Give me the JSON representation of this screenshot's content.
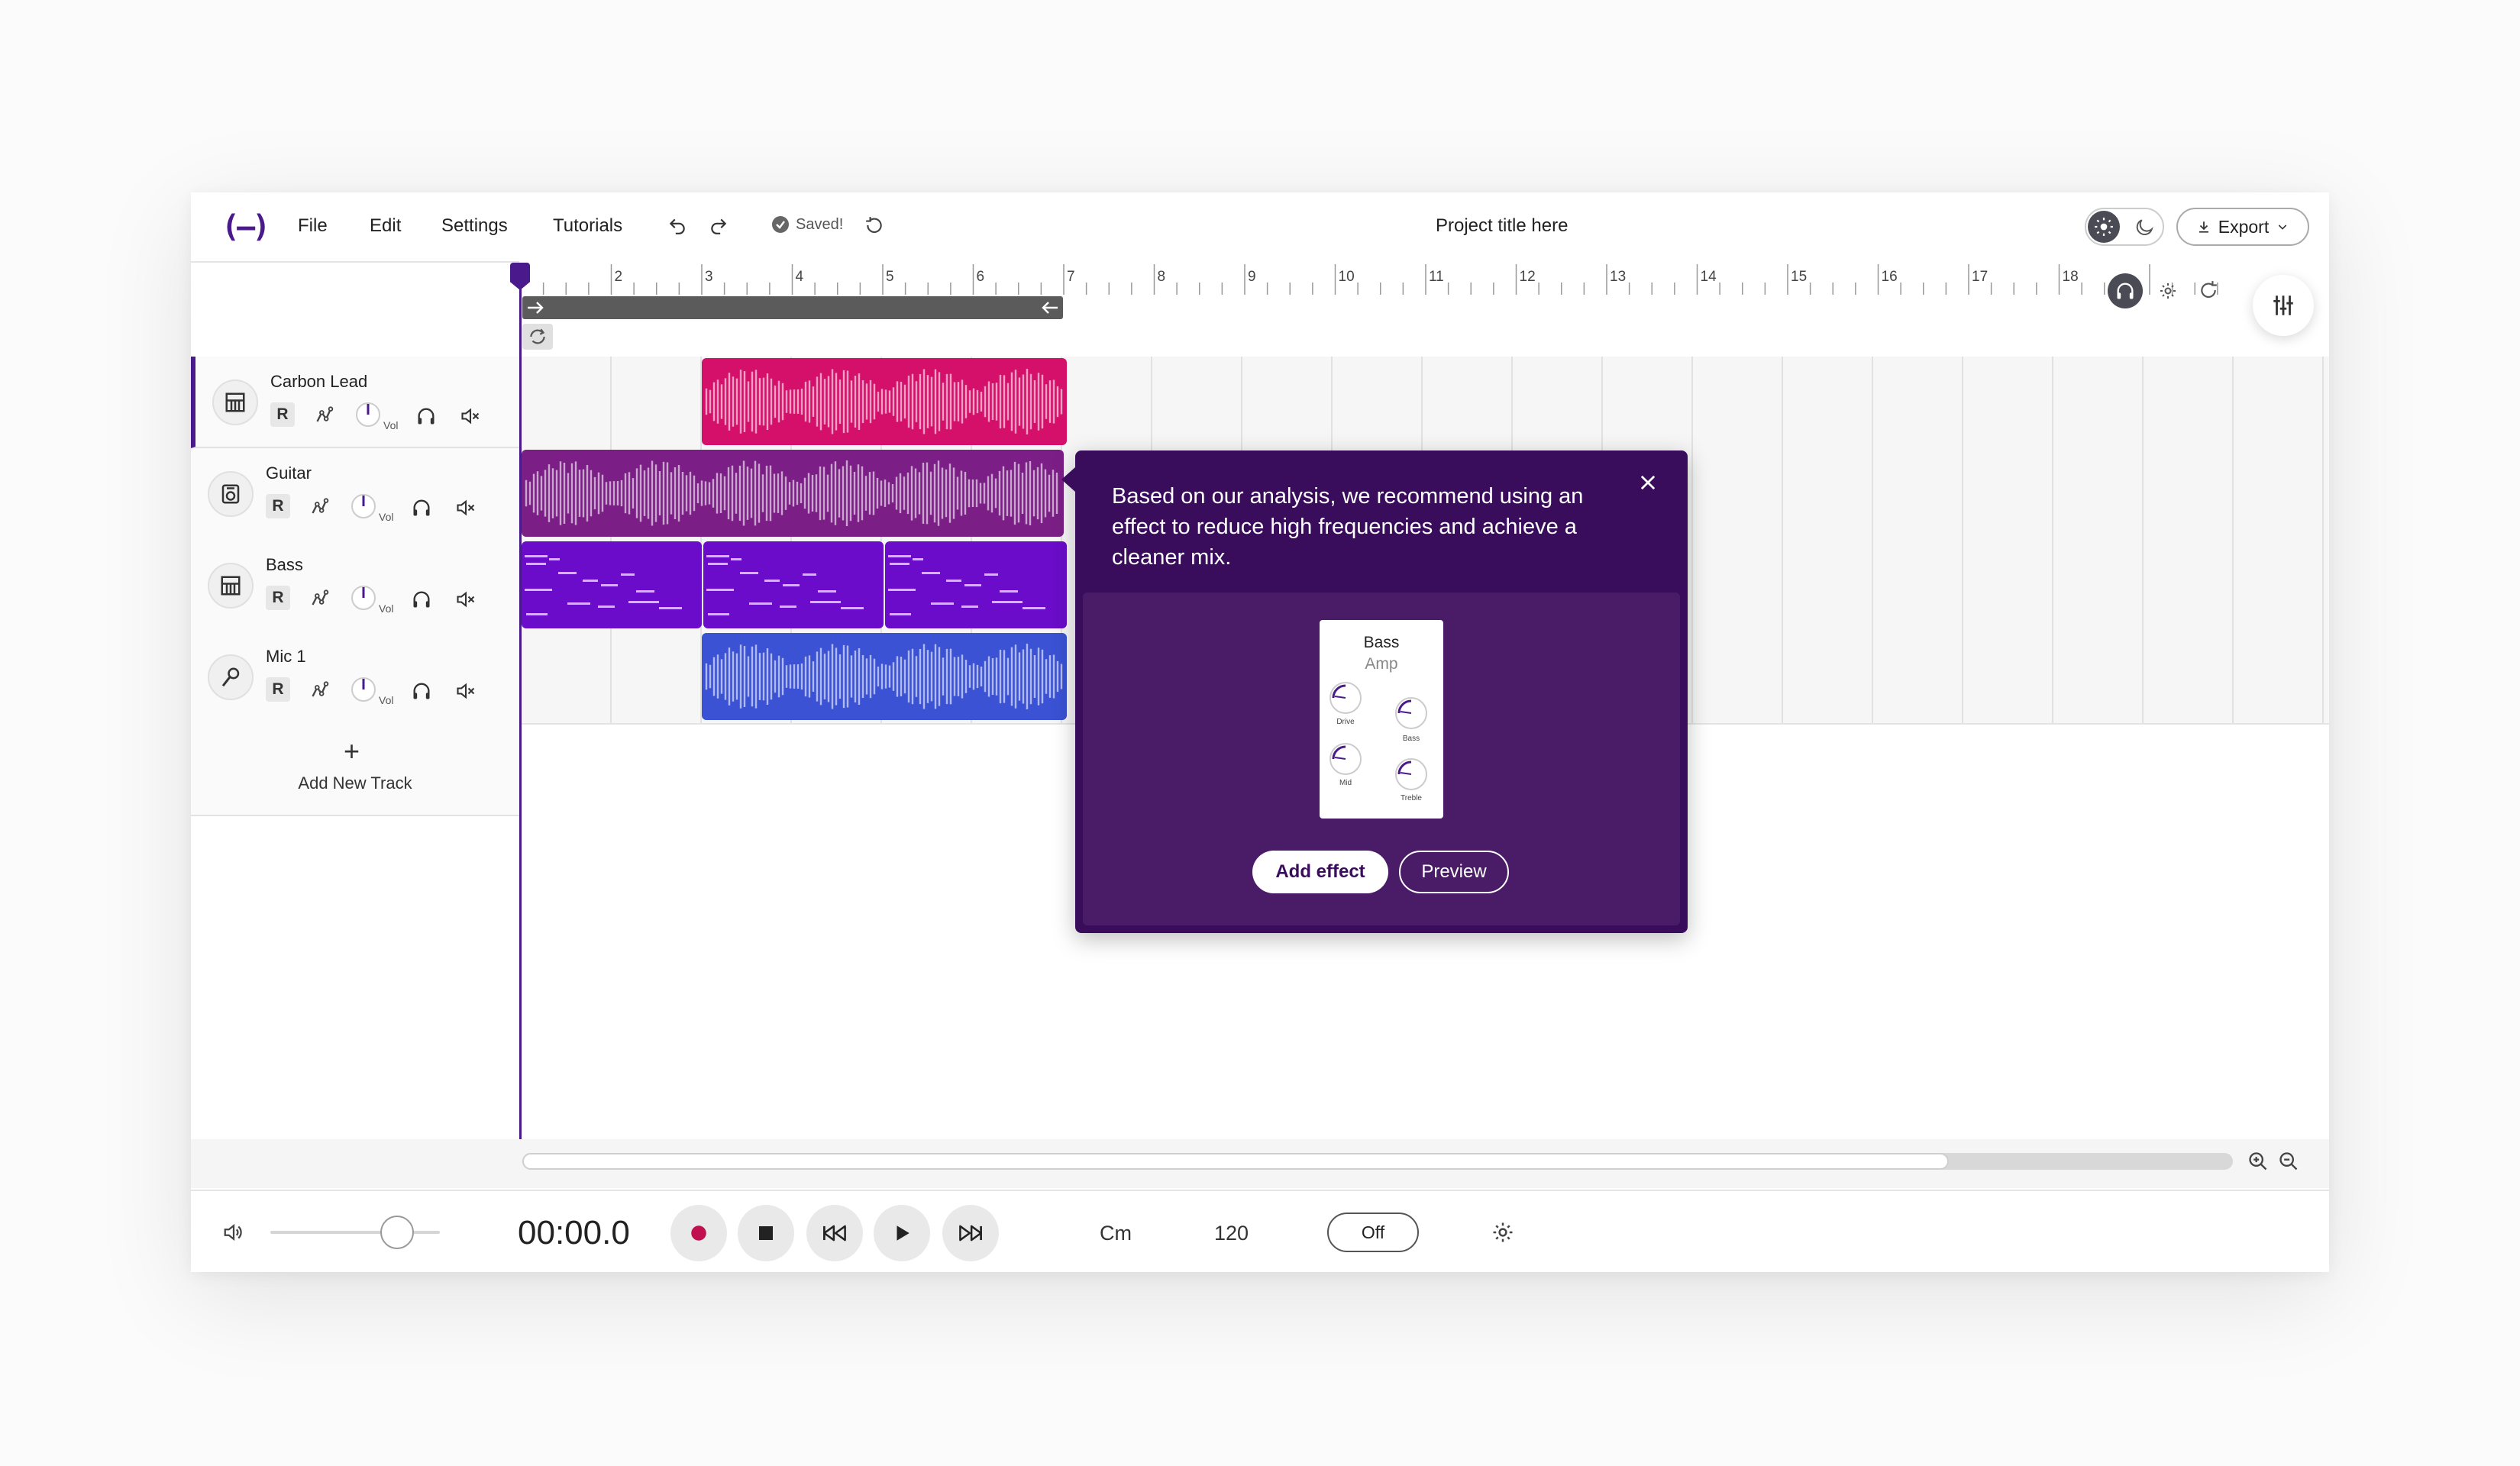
{
  "app": {
    "logo": "(—)"
  },
  "menu": {
    "file": "File",
    "edit": "Edit",
    "settings": "Settings",
    "tutorials": "Tutorials"
  },
  "status": {
    "saved": "Saved!"
  },
  "project": {
    "title": "Project title here"
  },
  "export": {
    "label": "Export"
  },
  "ruler": {
    "marks": [
      "2",
      "3",
      "4",
      "5",
      "6",
      "7",
      "8",
      "9",
      "10",
      "11",
      "12",
      "13",
      "14",
      "15",
      "16",
      "17",
      "18"
    ]
  },
  "tracks": [
    {
      "name": "Carbon Lead",
      "record": "R",
      "vol": "Vol",
      "icon": "keyboard-icon",
      "color": "#d4106b"
    },
    {
      "name": "Guitar",
      "record": "R",
      "vol": "Vol",
      "icon": "amp-icon",
      "color": "#7b1f86"
    },
    {
      "name": "Bass",
      "record": "R",
      "vol": "Vol",
      "icon": "keyboard-icon",
      "color": "#6a0cc9"
    },
    {
      "name": "Mic 1",
      "record": "R",
      "vol": "Vol",
      "icon": "microphone-icon",
      "color": "#3a52d3"
    }
  ],
  "add_track": {
    "label": "Add New Track"
  },
  "popup": {
    "message": "Based on our analysis, we recommend using an effect to reduce high frequencies and achieve a cleaner mix.",
    "effect_name": "Bass",
    "effect_type": "Amp",
    "knobs": [
      "Drive",
      "Bass",
      "Mid",
      "Treble"
    ],
    "add_label": "Add effect",
    "preview_label": "Preview"
  },
  "transport": {
    "time": "00:00.0",
    "key": "Cm",
    "tempo": "120",
    "metronome": "Off"
  },
  "colors": {
    "accent": "#4a1a8c",
    "popup_bg": "#3a0d5c",
    "record": "#c0104f"
  }
}
